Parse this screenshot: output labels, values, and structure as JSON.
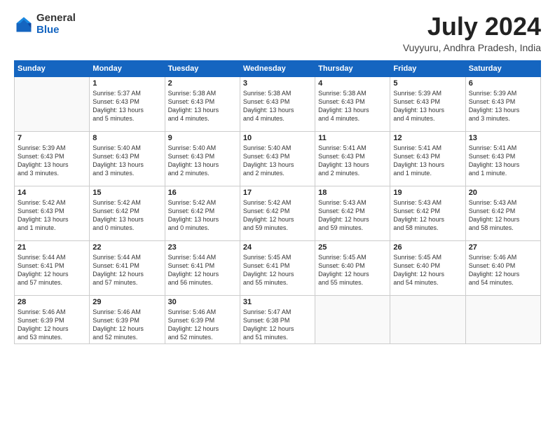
{
  "logo": {
    "general": "General",
    "blue": "Blue"
  },
  "title": "July 2024",
  "location": "Vuyyuru, Andhra Pradesh, India",
  "weekdays": [
    "Sunday",
    "Monday",
    "Tuesday",
    "Wednesday",
    "Thursday",
    "Friday",
    "Saturday"
  ],
  "weeks": [
    [
      {
        "day": "",
        "info": ""
      },
      {
        "day": "1",
        "info": "Sunrise: 5:37 AM\nSunset: 6:43 PM\nDaylight: 13 hours\nand 5 minutes."
      },
      {
        "day": "2",
        "info": "Sunrise: 5:38 AM\nSunset: 6:43 PM\nDaylight: 13 hours\nand 4 minutes."
      },
      {
        "day": "3",
        "info": "Sunrise: 5:38 AM\nSunset: 6:43 PM\nDaylight: 13 hours\nand 4 minutes."
      },
      {
        "day": "4",
        "info": "Sunrise: 5:38 AM\nSunset: 6:43 PM\nDaylight: 13 hours\nand 4 minutes."
      },
      {
        "day": "5",
        "info": "Sunrise: 5:39 AM\nSunset: 6:43 PM\nDaylight: 13 hours\nand 4 minutes."
      },
      {
        "day": "6",
        "info": "Sunrise: 5:39 AM\nSunset: 6:43 PM\nDaylight: 13 hours\nand 3 minutes."
      }
    ],
    [
      {
        "day": "7",
        "info": "Sunrise: 5:39 AM\nSunset: 6:43 PM\nDaylight: 13 hours\nand 3 minutes."
      },
      {
        "day": "8",
        "info": "Sunrise: 5:40 AM\nSunset: 6:43 PM\nDaylight: 13 hours\nand 3 minutes."
      },
      {
        "day": "9",
        "info": "Sunrise: 5:40 AM\nSunset: 6:43 PM\nDaylight: 13 hours\nand 2 minutes."
      },
      {
        "day": "10",
        "info": "Sunrise: 5:40 AM\nSunset: 6:43 PM\nDaylight: 13 hours\nand 2 minutes."
      },
      {
        "day": "11",
        "info": "Sunrise: 5:41 AM\nSunset: 6:43 PM\nDaylight: 13 hours\nand 2 minutes."
      },
      {
        "day": "12",
        "info": "Sunrise: 5:41 AM\nSunset: 6:43 PM\nDaylight: 13 hours\nand 1 minute."
      },
      {
        "day": "13",
        "info": "Sunrise: 5:41 AM\nSunset: 6:43 PM\nDaylight: 13 hours\nand 1 minute."
      }
    ],
    [
      {
        "day": "14",
        "info": "Sunrise: 5:42 AM\nSunset: 6:43 PM\nDaylight: 13 hours\nand 1 minute."
      },
      {
        "day": "15",
        "info": "Sunrise: 5:42 AM\nSunset: 6:42 PM\nDaylight: 13 hours\nand 0 minutes."
      },
      {
        "day": "16",
        "info": "Sunrise: 5:42 AM\nSunset: 6:42 PM\nDaylight: 13 hours\nand 0 minutes."
      },
      {
        "day": "17",
        "info": "Sunrise: 5:42 AM\nSunset: 6:42 PM\nDaylight: 12 hours\nand 59 minutes."
      },
      {
        "day": "18",
        "info": "Sunrise: 5:43 AM\nSunset: 6:42 PM\nDaylight: 12 hours\nand 59 minutes."
      },
      {
        "day": "19",
        "info": "Sunrise: 5:43 AM\nSunset: 6:42 PM\nDaylight: 12 hours\nand 58 minutes."
      },
      {
        "day": "20",
        "info": "Sunrise: 5:43 AM\nSunset: 6:42 PM\nDaylight: 12 hours\nand 58 minutes."
      }
    ],
    [
      {
        "day": "21",
        "info": "Sunrise: 5:44 AM\nSunset: 6:41 PM\nDaylight: 12 hours\nand 57 minutes."
      },
      {
        "day": "22",
        "info": "Sunrise: 5:44 AM\nSunset: 6:41 PM\nDaylight: 12 hours\nand 57 minutes."
      },
      {
        "day": "23",
        "info": "Sunrise: 5:44 AM\nSunset: 6:41 PM\nDaylight: 12 hours\nand 56 minutes."
      },
      {
        "day": "24",
        "info": "Sunrise: 5:45 AM\nSunset: 6:41 PM\nDaylight: 12 hours\nand 55 minutes."
      },
      {
        "day": "25",
        "info": "Sunrise: 5:45 AM\nSunset: 6:40 PM\nDaylight: 12 hours\nand 55 minutes."
      },
      {
        "day": "26",
        "info": "Sunrise: 5:45 AM\nSunset: 6:40 PM\nDaylight: 12 hours\nand 54 minutes."
      },
      {
        "day": "27",
        "info": "Sunrise: 5:46 AM\nSunset: 6:40 PM\nDaylight: 12 hours\nand 54 minutes."
      }
    ],
    [
      {
        "day": "28",
        "info": "Sunrise: 5:46 AM\nSunset: 6:39 PM\nDaylight: 12 hours\nand 53 minutes."
      },
      {
        "day": "29",
        "info": "Sunrise: 5:46 AM\nSunset: 6:39 PM\nDaylight: 12 hours\nand 52 minutes."
      },
      {
        "day": "30",
        "info": "Sunrise: 5:46 AM\nSunset: 6:39 PM\nDaylight: 12 hours\nand 52 minutes."
      },
      {
        "day": "31",
        "info": "Sunrise: 5:47 AM\nSunset: 6:38 PM\nDaylight: 12 hours\nand 51 minutes."
      },
      {
        "day": "",
        "info": ""
      },
      {
        "day": "",
        "info": ""
      },
      {
        "day": "",
        "info": ""
      }
    ]
  ]
}
